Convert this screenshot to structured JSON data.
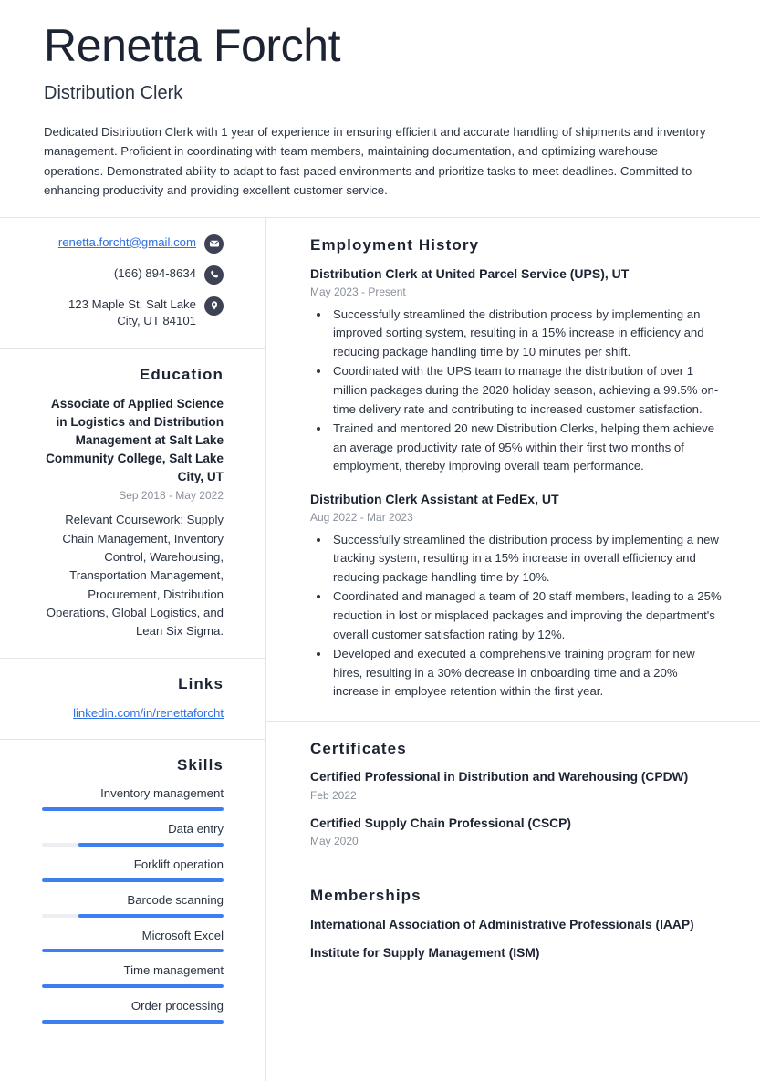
{
  "header": {
    "name": "Renetta Forcht",
    "title": "Distribution Clerk",
    "summary": "Dedicated Distribution Clerk with 1 year of experience in ensuring efficient and accurate handling of shipments and inventory management. Proficient in coordinating with team members, maintaining documentation, and optimizing warehouse operations. Demonstrated ability to adapt to fast-paced environments and prioritize tasks to meet deadlines. Committed to enhancing productivity and providing excellent customer service."
  },
  "contact": {
    "email": "renetta.forcht@gmail.com",
    "phone": "(166) 894-8634",
    "address": "123 Maple St, Salt Lake City, UT 84101",
    "icons": {
      "email": "envelope-icon",
      "phone": "phone-icon",
      "address": "map-pin-icon"
    }
  },
  "education": {
    "heading": "Education",
    "degree": "Associate of Applied Science in Logistics and Distribution Management at Salt Lake Community College, Salt Lake City, UT",
    "date": "Sep 2018 - May 2022",
    "description": "Relevant Coursework: Supply Chain Management, Inventory Control, Warehousing, Transportation Management, Procurement, Distribution Operations, Global Logistics, and Lean Six Sigma."
  },
  "links": {
    "heading": "Links",
    "items": [
      {
        "label": "linkedin.com/in/renettaforcht"
      }
    ]
  },
  "skills": {
    "heading": "Skills",
    "items": [
      {
        "name": "Inventory management",
        "level": 100
      },
      {
        "name": "Data entry",
        "level": 80
      },
      {
        "name": "Forklift operation",
        "level": 100
      },
      {
        "name": "Barcode scanning",
        "level": 80
      },
      {
        "name": "Microsoft Excel",
        "level": 100
      },
      {
        "name": "Time management",
        "level": 100
      },
      {
        "name": "Order processing",
        "level": 100
      }
    ]
  },
  "employment": {
    "heading": "Employment History",
    "jobs": [
      {
        "role": "Distribution Clerk at United Parcel Service (UPS), UT",
        "date": "May 2023 - Present",
        "bullets": [
          "Successfully streamlined the distribution process by implementing an improved sorting system, resulting in a 15% increase in efficiency and reducing package handling time by 10 minutes per shift.",
          "Coordinated with the UPS team to manage the distribution of over 1 million packages during the 2020 holiday season, achieving a 99.5% on-time delivery rate and contributing to increased customer satisfaction.",
          "Trained and mentored 20 new Distribution Clerks, helping them achieve an average productivity rate of 95% within their first two months of employment, thereby improving overall team performance."
        ]
      },
      {
        "role": "Distribution Clerk Assistant at FedEx, UT",
        "date": "Aug 2022 - Mar 2023",
        "bullets": [
          "Successfully streamlined the distribution process by implementing a new tracking system, resulting in a 15% increase in overall efficiency and reducing package handling time by 10%.",
          "Coordinated and managed a team of 20 staff members, leading to a 25% reduction in lost or misplaced packages and improving the department's overall customer satisfaction rating by 12%.",
          "Developed and executed a comprehensive training program for new hires, resulting in a 30% decrease in onboarding time and a 20% increase in employee retention within the first year."
        ]
      }
    ]
  },
  "certificates": {
    "heading": "Certificates",
    "items": [
      {
        "name": "Certified Professional in Distribution and Warehousing (CPDW)",
        "date": "Feb 2022"
      },
      {
        "name": "Certified Supply Chain Professional (CSCP)",
        "date": "May 2020"
      }
    ]
  },
  "memberships": {
    "heading": "Memberships",
    "items": [
      {
        "name": "International Association of Administrative Professionals (IAAP)"
      },
      {
        "name": "Institute for Supply Management (ISM)"
      }
    ]
  },
  "colors": {
    "accent": "#3d7ff0",
    "link": "#2f6fe0",
    "icon_bg": "#3d4354",
    "text": "#2b3443",
    "muted": "#8a909b",
    "rule": "#e2e5e9"
  }
}
